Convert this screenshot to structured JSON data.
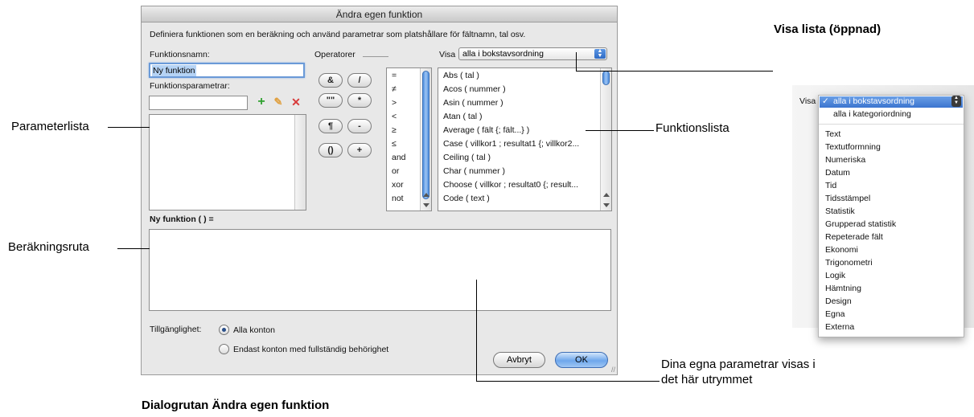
{
  "dialog": {
    "title": "Ändra egen funktion",
    "instructions": "Definiera funktionen som en beräkning och använd parametrar som platshållare för fältnamn, tal osv.",
    "function_name_label": "Funktionsnamn:",
    "function_name_value": "Ny funktion",
    "function_params_label": "Funktionsparametrar:",
    "param_input_value": "",
    "operators_label": "Operatorer",
    "show_label": "Visa",
    "show_selected": "alla i bokstavsordning",
    "operator_buttons": [
      "&",
      "/",
      "\"\"",
      "*",
      "¶",
      "-",
      "()",
      "+"
    ],
    "operators_list": [
      "=",
      "≠",
      ">",
      "<",
      "≥",
      "≤",
      "and",
      "or",
      "xor",
      "not"
    ],
    "functions_list": [
      "Abs ( tal )",
      "Acos ( nummer )",
      "Asin ( nummer )",
      "Atan ( tal )",
      "Average ( fält {; fält...} )",
      "Case ( villkor1 ; resultat1 {; villkor2...",
      "Ceiling ( tal )",
      "Char ( nummer )",
      "Choose ( villkor ; resultat0 {; result...",
      "Code ( text )"
    ],
    "formula_header": "Ny funktion (  ) =",
    "formula_value": "",
    "availability_label": "Tillgänglighet:",
    "availability_options": [
      "Alla konton",
      "Endast konton med fullständig behörighet"
    ],
    "cancel_label": "Avbryt",
    "ok_label": "OK"
  },
  "annotations": {
    "parameter_list": "Parameterlista",
    "calculation_box": "Beräkningsruta",
    "function_list": "Funktionslista",
    "show_list_open": "Visa lista (öppnad)",
    "own_params_line1": "Dina egna parametrar visas i",
    "own_params_line2": "det här utrymmet",
    "caption": "Dialogrutan Ändra egen funktion"
  },
  "dropdown": {
    "show_label": "Visa",
    "checkmark": "✓",
    "items_top": [
      "alla i bokstavsordning",
      "alla i kategoriordning"
    ],
    "items_categories": [
      "Text",
      "Textutformning",
      "Numeriska",
      "Datum",
      "Tid",
      "Tidsstämpel",
      "Statistik",
      "Grupperad statistik",
      "Repeterade fält",
      "Ekonomi",
      "Trigonometri",
      "Logik",
      "Hämtning",
      "Design",
      "Egna",
      "Externa"
    ]
  },
  "icons": {
    "add": "plus-icon",
    "edit": "pencil-icon",
    "delete": "delete-x-icon"
  },
  "colors": {
    "selection": "#b5d3f5",
    "scroll_thumb": "#4e8fe0",
    "default_button": "#6ea7ec",
    "add_icon": "#2fa12f",
    "delete_icon": "#d83a3a"
  }
}
